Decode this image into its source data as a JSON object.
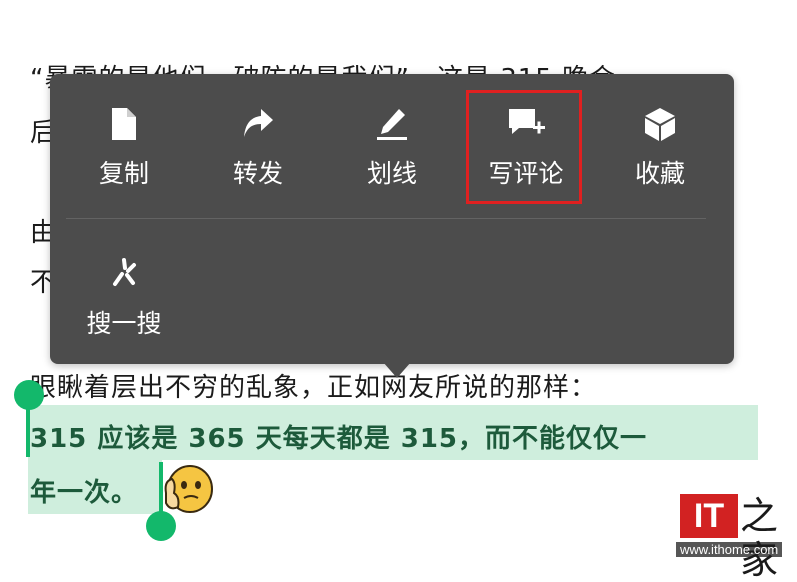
{
  "article": {
    "lines": [
      "“暴雷的是他们，破防的是我们”，这是 315 晚会",
      "后",
      "由",
      "不",
      "眼瞅着层出不穷的乱象，正如网友所说的那样："
    ],
    "selected_lines": [
      "315 应该是 365 天每天都是 315，而不能仅仅一",
      "年一次。"
    ]
  },
  "context_menu": {
    "items": [
      {
        "label": "复制",
        "icon": "document-icon"
      },
      {
        "label": "转发",
        "icon": "share-arrow-icon"
      },
      {
        "label": "划线",
        "icon": "pen-underline-icon"
      },
      {
        "label": "写评论",
        "icon": "comment-add-icon"
      },
      {
        "label": "收藏",
        "icon": "cube-icon"
      },
      {
        "label": "搜一搜",
        "icon": "sparkle-search-icon"
      }
    ],
    "highlighted_item": "写评论"
  },
  "watermark": {
    "logo_text": "IT",
    "logo_char": "之家",
    "url": "www.ithome.com"
  },
  "colors": {
    "menu_bg": "#4c4c4c",
    "selection": "#cfeedd",
    "handle": "#13b86b",
    "highlight_box": "#e02020"
  }
}
